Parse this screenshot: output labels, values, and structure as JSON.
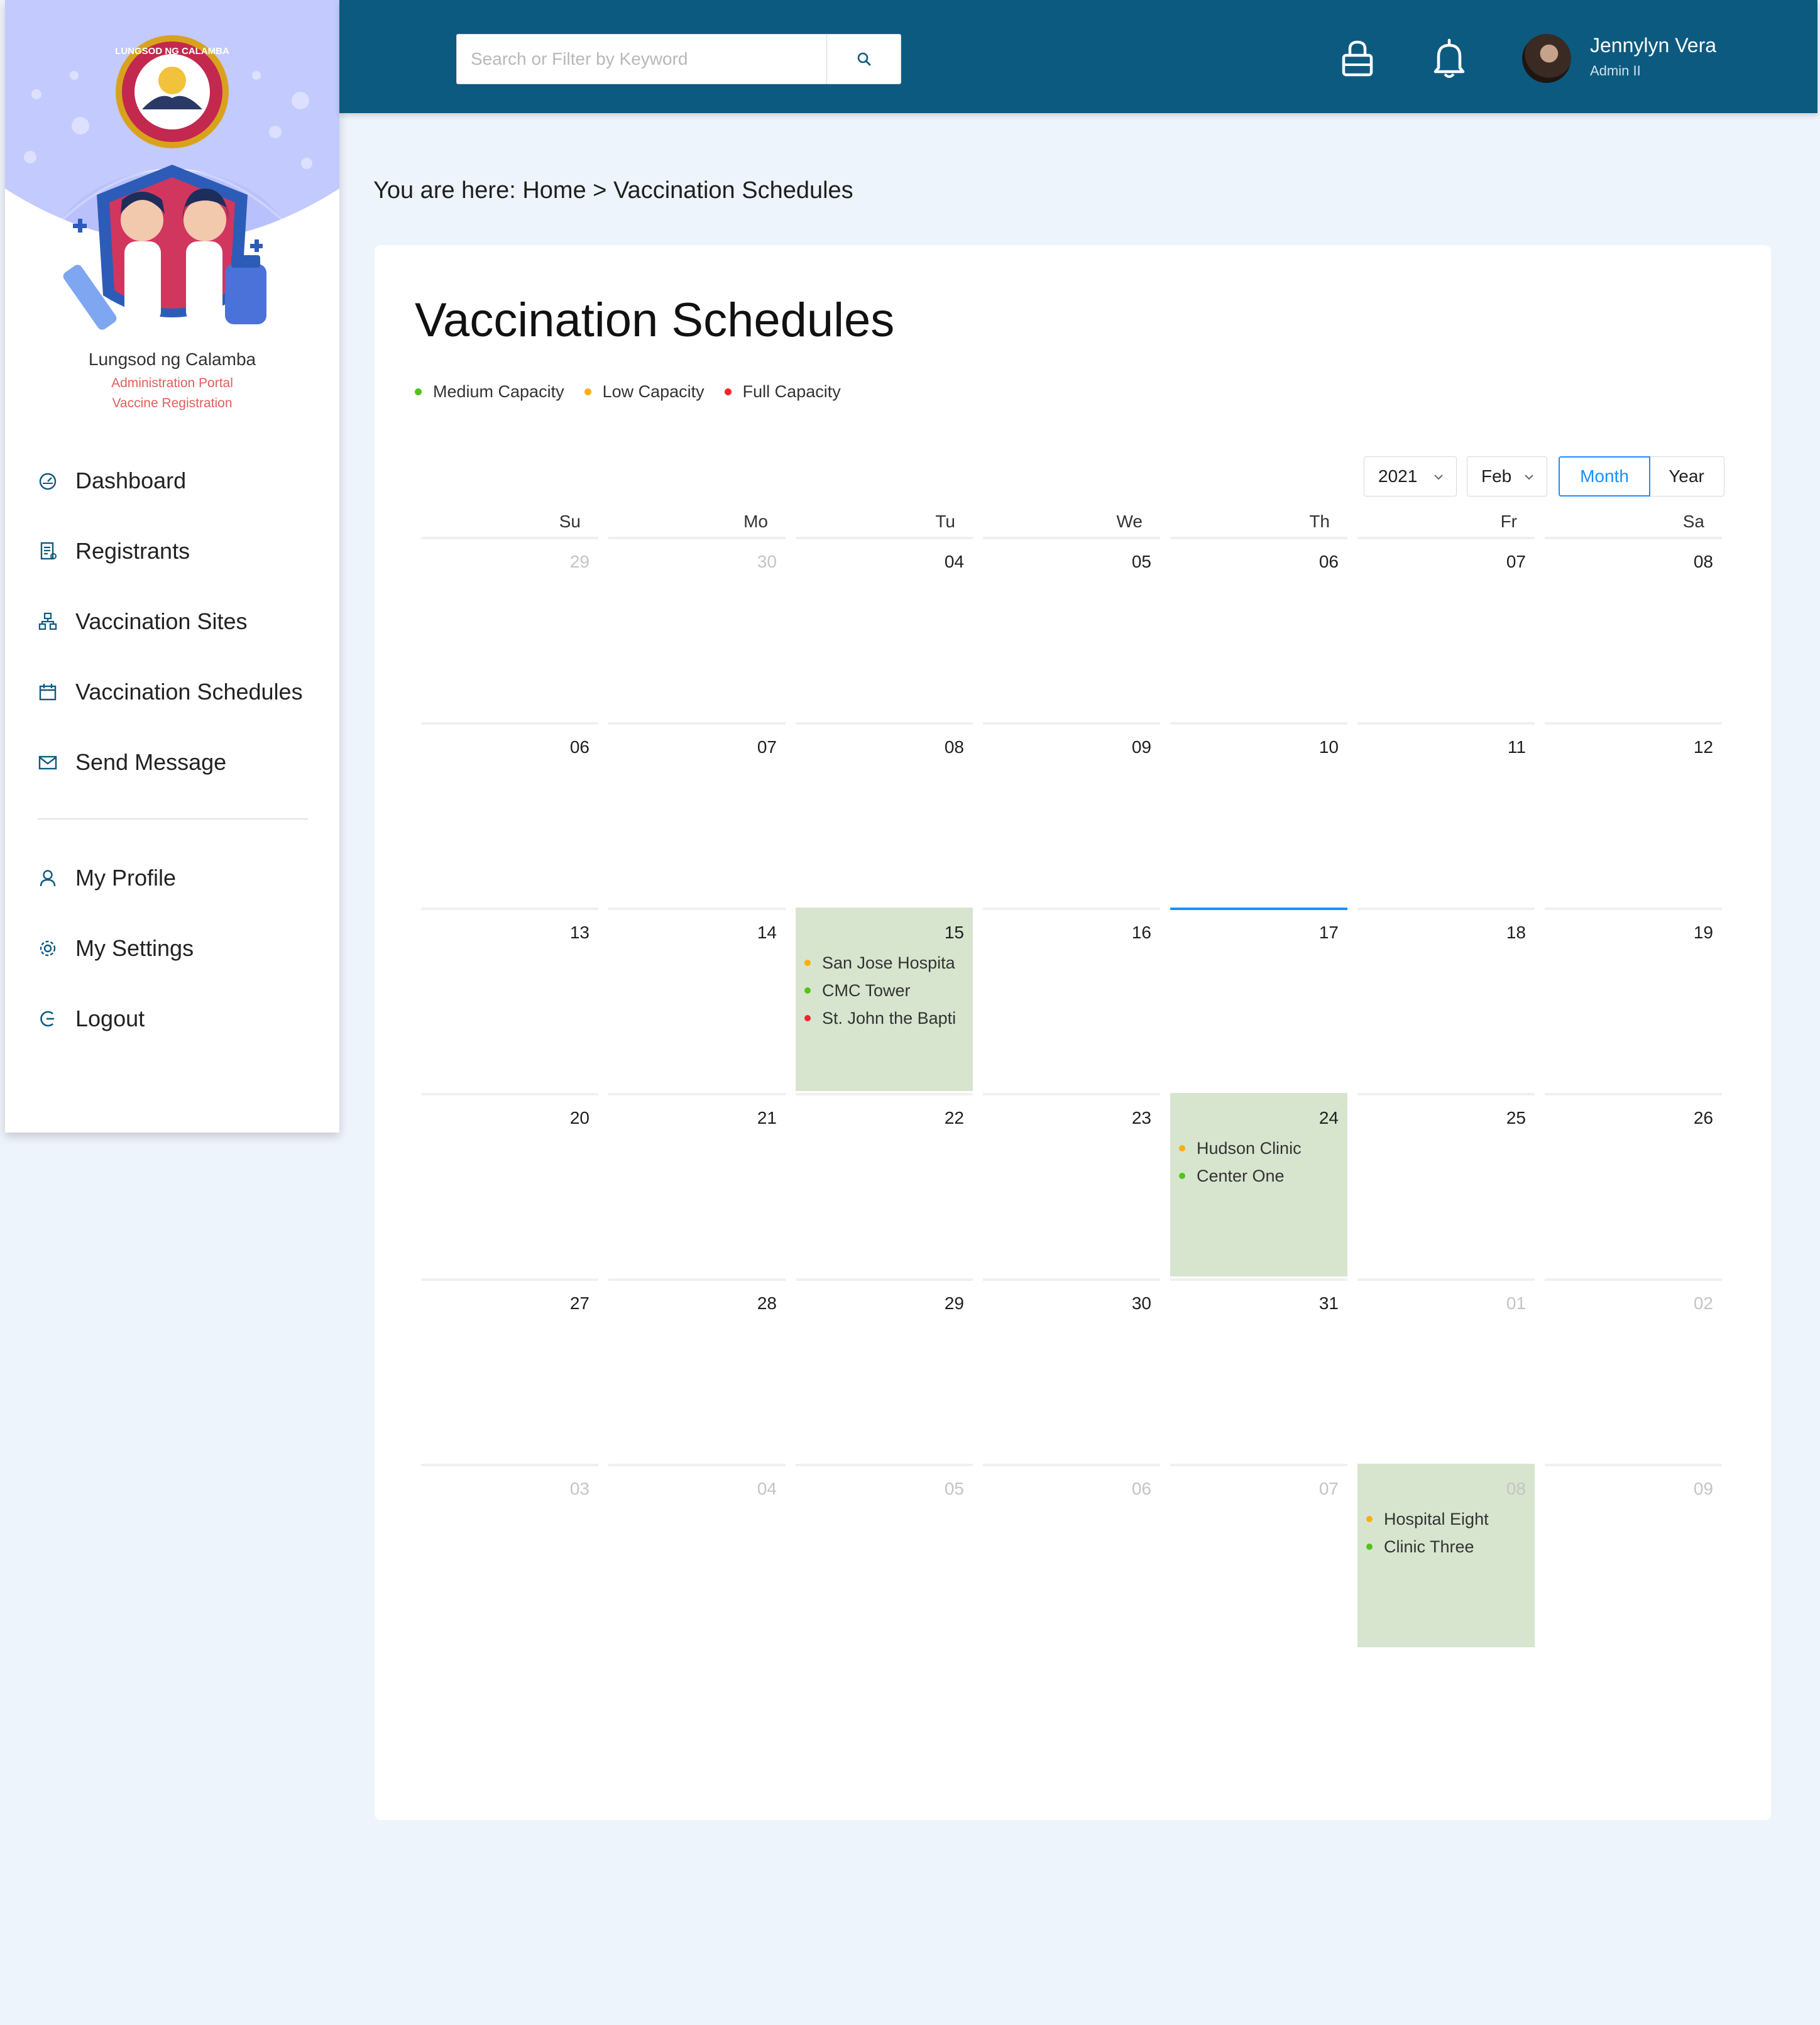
{
  "colors": {
    "topbar": "#0d5a80",
    "accent": "#1890ff",
    "event_bg": "#d7e5cf",
    "medium": "#52c41a",
    "low": "#faad14",
    "full": "#f5222d"
  },
  "brand": {
    "seal_text": "LUNGSOD NG CALAMBA",
    "name": "Lungsod ng Calamba",
    "line1": "Administration Portal",
    "line2": "Vaccine Registration"
  },
  "nav": {
    "primary": [
      {
        "label": "Dashboard",
        "icon": "dashboard-icon"
      },
      {
        "label": "Registrants",
        "icon": "registrants-icon"
      },
      {
        "label": "Vaccination Sites",
        "icon": "sites-icon"
      },
      {
        "label": "Vaccination Schedules",
        "icon": "calendar-icon"
      },
      {
        "label": "Send Message",
        "icon": "mail-icon"
      }
    ],
    "secondary": [
      {
        "label": "My Profile",
        "icon": "user-icon"
      },
      {
        "label": "My Settings",
        "icon": "gear-icon"
      },
      {
        "label": "Logout",
        "icon": "logout-icon"
      }
    ]
  },
  "header": {
    "search_placeholder": "Search or Filter by Keyword",
    "search_icon": "search-icon",
    "lock_icon": "lock-icon",
    "bell_icon": "bell-icon",
    "user_name": "Jennylyn Vera",
    "user_role": "Admin II"
  },
  "breadcrumb": {
    "prefix": "You are here: ",
    "home": "Home",
    "sep": " > ",
    "current": "Vaccination Schedules"
  },
  "page": {
    "title": "Vaccination Schedules",
    "legend": [
      {
        "label": "Medium Capacity",
        "color": "#52c41a"
      },
      {
        "label": "Low Capacity",
        "color": "#faad14"
      },
      {
        "label": "Full Capacity",
        "color": "#f5222d"
      }
    ]
  },
  "calendar": {
    "year": "2021",
    "month": "Feb",
    "mode_month": "Month",
    "mode_year": "Year",
    "weekdays": [
      "Su",
      "Mo",
      "Tu",
      "We",
      "Th",
      "Fr",
      "Sa"
    ],
    "weeks": [
      [
        {
          "d": "29",
          "muted": true
        },
        {
          "d": "30",
          "muted": true
        },
        {
          "d": "04"
        },
        {
          "d": "05"
        },
        {
          "d": "06"
        },
        {
          "d": "07"
        },
        {
          "d": "08"
        }
      ],
      [
        {
          "d": "06"
        },
        {
          "d": "07"
        },
        {
          "d": "08"
        },
        {
          "d": "09"
        },
        {
          "d": "10"
        },
        {
          "d": "11"
        },
        {
          "d": "12"
        }
      ],
      [
        {
          "d": "13"
        },
        {
          "d": "14"
        },
        {
          "d": "15",
          "events": [
            {
              "name": "San Jose Hospita",
              "color": "#faad14"
            },
            {
              "name": "CMC Tower",
              "color": "#52c41a"
            },
            {
              "name": "St. John the Bapti",
              "color": "#f5222d"
            }
          ]
        },
        {
          "d": "16"
        },
        {
          "d": "17",
          "today": true
        },
        {
          "d": "18"
        },
        {
          "d": "19"
        }
      ],
      [
        {
          "d": "20"
        },
        {
          "d": "21"
        },
        {
          "d": "22"
        },
        {
          "d": "23"
        },
        {
          "d": "24",
          "events": [
            {
              "name": "Hudson Clinic",
              "color": "#faad14"
            },
            {
              "name": "Center One",
              "color": "#52c41a"
            }
          ]
        },
        {
          "d": "25"
        },
        {
          "d": "26"
        }
      ],
      [
        {
          "d": "27"
        },
        {
          "d": "28"
        },
        {
          "d": "29"
        },
        {
          "d": "30"
        },
        {
          "d": "31"
        },
        {
          "d": "01",
          "muted": true
        },
        {
          "d": "02",
          "muted": true
        }
      ],
      [
        {
          "d": "03",
          "muted": true
        },
        {
          "d": "04",
          "muted": true
        },
        {
          "d": "05",
          "muted": true
        },
        {
          "d": "06",
          "muted": true
        },
        {
          "d": "07",
          "muted": true
        },
        {
          "d": "08",
          "muted": true,
          "events": [
            {
              "name": "Hospital Eight",
              "color": "#faad14"
            },
            {
              "name": "Clinic Three",
              "color": "#52c41a"
            }
          ]
        },
        {
          "d": "09",
          "muted": true
        }
      ]
    ]
  }
}
